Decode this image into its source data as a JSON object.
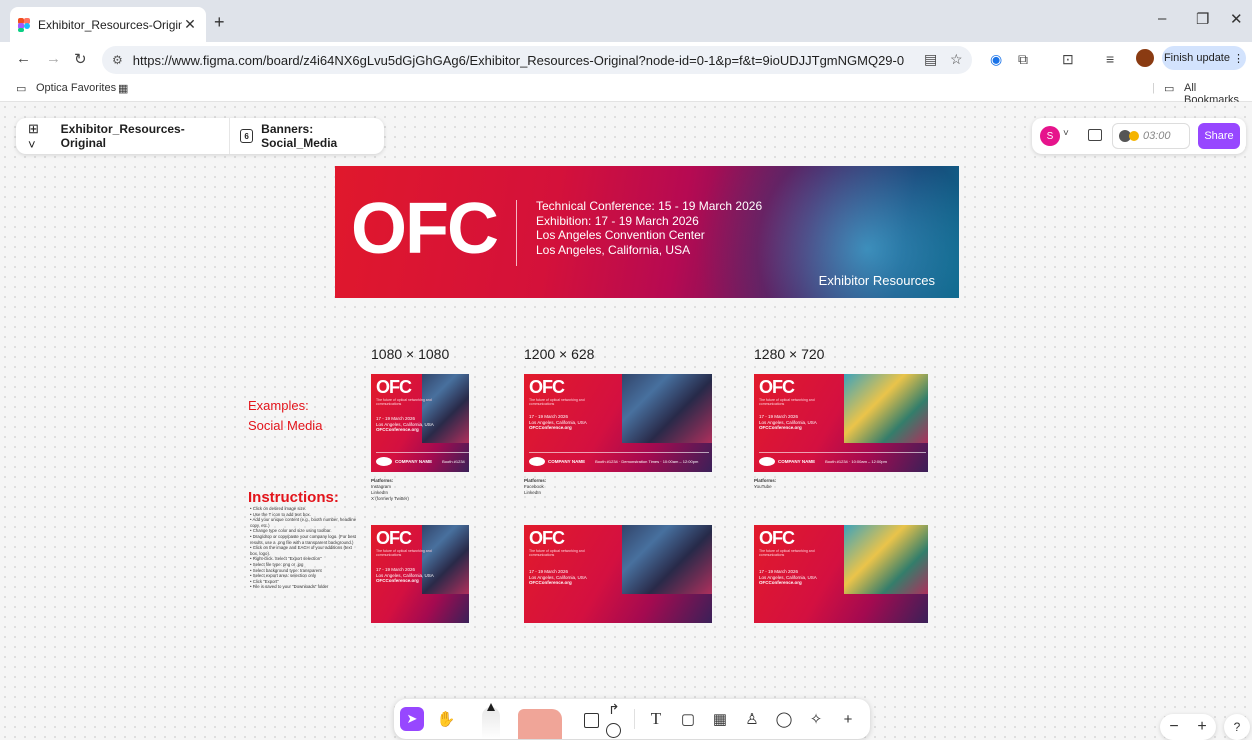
{
  "browser": {
    "tab_title": "Exhibitor_Resources-Original – F",
    "tab_close": "✕",
    "new_tab": "+",
    "url": "https://www.figma.com/board/z4i64NX6gLvu5dGjGhGAg6/Exhibitor_Resources-Original?node-id=0-1&p=f&t=9ioUDJJTgmNGMQ29-0",
    "finish_update_label": "Finish update",
    "bookmarks": {
      "folder_label": "Optica Favorites",
      "all_bookmarks_label": "All Bookmarks"
    }
  },
  "figma": {
    "file_name": "Exhibitor_Resources-Original",
    "page_name": "Banners: Social_Media",
    "page_icon_text": "6",
    "user_initial": "S",
    "timer": "03:00",
    "share_label": "Share"
  },
  "banner": {
    "logo": "OFC",
    "lines": [
      "Technical Conference: 15 - 19 March 2026",
      "Exhibition: 17 - 19 March 2026",
      "Los Angeles Convention Center",
      "Los Angeles, California, USA"
    ],
    "exhibitor_label": "Exhibitor Resources"
  },
  "sizes": [
    "1080 × 1080",
    "1200 × 628",
    "1280 × 720"
  ],
  "examples_heading": [
    "Examples:",
    "Social Media"
  ],
  "instructions": {
    "title": "Instructions:",
    "steps": [
      "Click on desired image size.",
      "Use the T icon to add text box.",
      "Add your unique content (e.g., booth number, headline copy, etc.)",
      "Change type color and size using toolbar.",
      "Drag/drop or copy/paste your company logo. (For best results, use a .png file with a transparent background.)",
      "Click on the image and EACH of your additions (text box, logo).",
      "Right-click. Select \"Export selection\"",
      "Select file type: png or .jpg",
      "Select background type: transparent",
      "Select export area: selection only",
      "Click \"Export\"",
      "File is saved to your \"Downloads\" folder"
    ]
  },
  "thumb": {
    "logo": "OFC",
    "subline": "The future of optical networking and communications",
    "date": "17 - 19 March 2026",
    "location": "Los Angeles, California, USA",
    "site": "OFCConference.org",
    "company": "COMPANY NAME",
    "booth": "Booth #1234",
    "demo": "Demonstration Times",
    "demo_time": "10:00am – 12:00pm"
  },
  "platforms": [
    {
      "title": "Platforms:",
      "items": [
        "Instagram",
        "LinkedIn",
        "X (formerly Twitter)"
      ]
    },
    {
      "title": "Platforms:",
      "items": [
        "Facebook",
        "LinkedIn"
      ]
    },
    {
      "title": "Platforms:",
      "items": [
        "YouTube"
      ]
    }
  ],
  "colors": {
    "accent_purple": "#9747ff",
    "heading_red": "#e3141b"
  }
}
